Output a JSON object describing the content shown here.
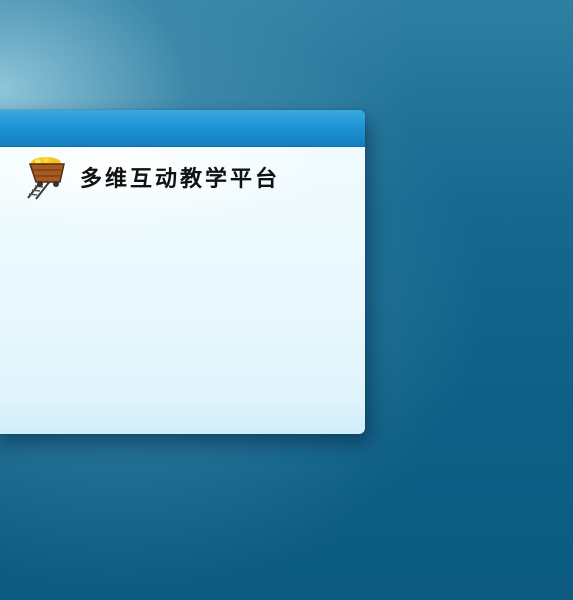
{
  "app": {
    "title": "多维互动教学平台",
    "logo_icon": "mine-cart-icon"
  },
  "colors": {
    "background": "#0e5f86",
    "header_bar": "#1f95d4",
    "panel": "#eaf8fe"
  }
}
